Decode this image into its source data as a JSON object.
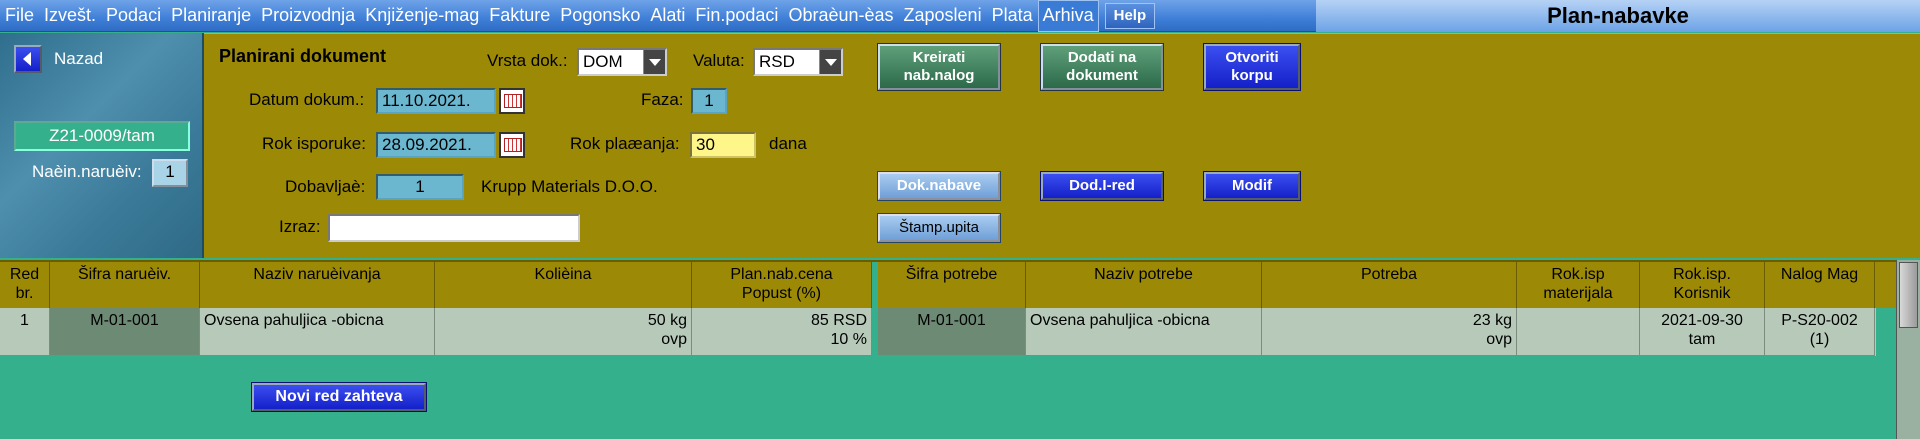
{
  "menu": {
    "items": [
      "File",
      "Izvešt.",
      "Podaci",
      "Planiranje",
      "Proizvodnja",
      "Knjiženje-mag",
      "Fakture",
      "Pogonsko",
      "Alati",
      "Fin.podaci",
      "Obraèun-èas",
      "Zaposleni",
      "Plata",
      "Arhiva"
    ],
    "help": "Help"
  },
  "title": "Plan-nabavke",
  "left": {
    "back_label": "Nazad",
    "doc_number": "Z21-0009/tam",
    "order_method_label": "Naèin.naruèiv:",
    "order_method_value": "1"
  },
  "form": {
    "section_title": "Planirani dokument",
    "doc_type_label": "Vrsta dok.:",
    "doc_type_value": "DOM",
    "currency_label": "Valuta:",
    "currency_value": "RSD",
    "doc_date_label": "Datum dokum.:",
    "doc_date_value": "11.10.2021.",
    "phase_label": "Faza:",
    "phase_value": "1",
    "delivery_label": "Rok isporuke:",
    "delivery_value": "28.09.2021.",
    "payment_label": "Rok plaæanja:",
    "payment_value": "30",
    "payment_unit": "dana",
    "supplier_label": "Dobavljaè:",
    "supplier_code": "1",
    "supplier_name": "Krupp Materials D.O.O.",
    "izraz_label": "Izraz:",
    "izraz_value": ""
  },
  "buttons": {
    "create_order": "Kreirati nab.nalog",
    "add_to_doc": "Dodati na dokument",
    "open_cart": "Otvoriti korpu",
    "doc_nabave": "Dok.nabave",
    "dod_red": "Dod.I-red",
    "modif": "Modif",
    "stamp_upita": "Štamp.upita",
    "new_row": "Novi red zahteva"
  },
  "table": {
    "headers": {
      "red_br": "Red br.",
      "sifra_naruc": "Šifra naruèiv.",
      "naziv_naruc": "Naziv naruèivanja",
      "kolicina": "Kolièina",
      "plan_cena": "Plan.nab.cena Popust (%)",
      "sifra_potrebe": "Šifra potrebe",
      "naziv_potrebe": "Naziv potrebe",
      "potreba": "Potreba",
      "rok_mat": "Rok.isp materijala",
      "rok_kor": "Rok.isp. Korisnik",
      "nalog_mag": "Nalog Mag"
    },
    "rows": [
      {
        "red_br": "1",
        "sifra_naruc": "M-01-001",
        "naziv_naruc": "Ovsena pahuljica -obicna",
        "kolicina": "50 kg",
        "kolicina_unit": "ovp",
        "cena": "85 RSD",
        "popust": "10 %",
        "sifra_potrebe": "M-01-001",
        "naziv_potrebe": "Ovsena pahuljica -obicna",
        "potreba": "23 kg",
        "potreba_unit": "ovp",
        "rok_mat": "",
        "rok_kor": "2021-09-30",
        "rok_kor_user": "tam",
        "nalog_mag": "P-S20-002",
        "nalog_mag_sub": "(1)"
      }
    ]
  },
  "colors": {
    "menubar": "#3f7fd8",
    "form_bg": "#9c8a07",
    "grid_bg": "#34b18c",
    "field_blue": "#6ab7cf",
    "button_blue": "#1420c8",
    "button_green": "#2c6a4a"
  }
}
